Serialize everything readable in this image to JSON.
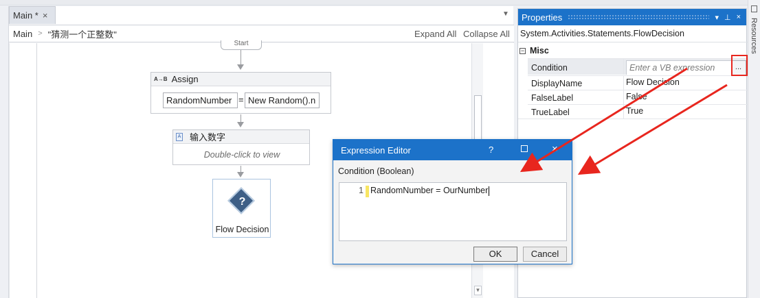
{
  "designer": {
    "tab": {
      "label": "Main *",
      "close": "×"
    },
    "breadcrumb": {
      "root": "Main",
      "current": "\"猜测一个正整数\""
    },
    "expand_all": "Expand All",
    "collapse_all": "Collapse All",
    "start_label": "Start",
    "assign": {
      "icon_text": "A→B",
      "title": "Assign",
      "to": "RandomNumber",
      "eq": "=",
      "value": "New Random().n"
    },
    "input_activity": {
      "title": "输入数字",
      "hint": "Double-click to view"
    },
    "flow_decision": {
      "symbol": "?",
      "label": "Flow Decision"
    }
  },
  "properties": {
    "title": "Properties",
    "pin": "⊥",
    "close": "×",
    "type_name": "System.Activities.Statements.FlowDecision",
    "category": "Misc",
    "rows": [
      {
        "name": "Condition",
        "placeholder": "Enter a VB expression",
        "button": "..."
      },
      {
        "name": "DisplayName",
        "value": "Flow Decision"
      },
      {
        "name": "FalseLabel",
        "value": "False"
      },
      {
        "name": "TrueLabel",
        "value": "True"
      }
    ]
  },
  "side_rail": {
    "label": "Resources"
  },
  "dialog": {
    "title": "Expression Editor",
    "help": "?",
    "close": "×",
    "label": "Condition (Boolean)",
    "line_number": "1",
    "code": "RandomNumber = OurNumber",
    "ok": "OK",
    "cancel": "Cancel"
  },
  "colors": {
    "accent": "#1c72c9",
    "annotation": "#e8261e"
  }
}
